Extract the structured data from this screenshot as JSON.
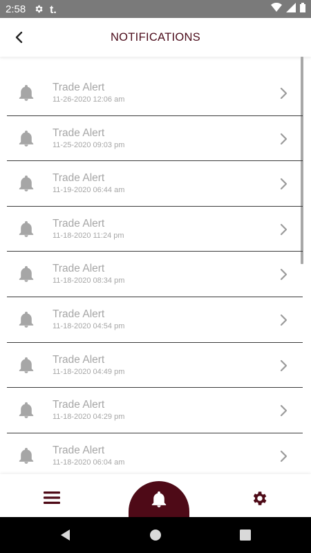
{
  "status_bar": {
    "time": "2:58",
    "icons": [
      "settings-icon",
      "tumblr-icon"
    ],
    "right_icons": [
      "wifi-icon",
      "signal-icon",
      "battery-icon"
    ]
  },
  "header": {
    "title": "NOTIFICATIONS",
    "back_icon": "back-arrow-icon"
  },
  "notifications": [
    {
      "title": "Trade Alert",
      "date": "11-26-2020 12:06 am"
    },
    {
      "title": "Trade Alert",
      "date": "11-25-2020 09:03 pm"
    },
    {
      "title": "Trade Alert",
      "date": "11-19-2020 06:44 am"
    },
    {
      "title": "Trade Alert",
      "date": "11-18-2020 11:24 pm"
    },
    {
      "title": "Trade Alert",
      "date": "11-18-2020 08:34 pm"
    },
    {
      "title": "Trade Alert",
      "date": "11-18-2020 04:54 pm"
    },
    {
      "title": "Trade Alert",
      "date": "11-18-2020 04:49 pm"
    },
    {
      "title": "Trade Alert",
      "date": "11-18-2020 04:29 pm"
    },
    {
      "title": "Trade Alert",
      "date": "11-18-2020 06:04 am"
    }
  ],
  "bottom_nav": {
    "left": "menu-icon",
    "center": "bell-icon",
    "right": "gear-icon",
    "active": "center"
  },
  "colors": {
    "brand": "#4e0a17",
    "muted_text": "#a6a6a6",
    "status_bar": "#7a7a7a"
  }
}
